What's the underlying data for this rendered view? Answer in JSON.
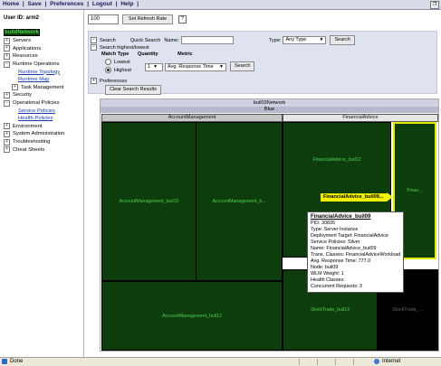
{
  "topbar": {
    "nav": [
      "Home",
      "|",
      "Save",
      "|",
      "Preferences",
      "|",
      "Logout",
      "|",
      "Help",
      "|"
    ],
    "corner_icon": "restore-icon"
  },
  "left": {
    "user": "User ID: arm2",
    "cell": "buildNetwork",
    "tree": [
      {
        "label": "Servers",
        "expand": "+",
        "type": "node"
      },
      {
        "label": "Applications",
        "expand": "+",
        "type": "node"
      },
      {
        "label": "Resources",
        "expand": "+",
        "type": "node"
      },
      {
        "label": "Runtime Operations",
        "expand": "−",
        "type": "node"
      },
      {
        "label": "Runtime Topology",
        "type": "link"
      },
      {
        "label": "Runtime Map",
        "type": "link"
      },
      {
        "label": "Task Management",
        "expand": "+",
        "type": "subnode"
      },
      {
        "label": "Security",
        "expand": "+",
        "type": "node"
      },
      {
        "label": "Operational Policies",
        "expand": "−",
        "type": "node"
      },
      {
        "label": "Service Policies",
        "type": "link"
      },
      {
        "label": "Health Policies",
        "type": "link"
      },
      {
        "label": "Environment",
        "expand": "+",
        "type": "node"
      },
      {
        "label": "System Administration",
        "expand": "+",
        "type": "node"
      },
      {
        "label": "Troubleshooting",
        "expand": "+",
        "type": "node"
      },
      {
        "label": "Cheat Sheets",
        "expand": "+",
        "type": "node"
      }
    ]
  },
  "toolbar": {
    "refresh_value": "100",
    "set_refresh": "Set Refresh Rate",
    "help": "?"
  },
  "search": {
    "search_label": "Search",
    "quick_search": "Quick Search",
    "name_label": "Name:",
    "type_label": "Type:",
    "type_value": "Any Type",
    "search_button": "Search",
    "highest_lowest": "Search highest/lowest",
    "match_type": "Match Type",
    "quantity": "Quantity",
    "metric": "Metric",
    "lowest": "Lowest",
    "highest": "Highest",
    "quantity_value": "1",
    "metric_value": "Avg. Response Time",
    "search_button2": "Search",
    "preferences": "Preferences",
    "clear": "Clear Search Results"
  },
  "map": {
    "root": "buil03Network",
    "group": "Blue",
    "am_header": "AccountManagement",
    "fa_header": "FinancialAdvice",
    "am1": "AccountManagement_buil10",
    "am2": "AccountManagement_b...",
    "am3": "AccountManagement_buil12",
    "fa1": "FinancialAdvice_buil12",
    "fa_sel": "Finan...",
    "st1": "StockTrade_buil13",
    "st2": "StockTrade_...",
    "callout": "FinancialAdvice_buil09..."
  },
  "tooltip": {
    "title": "FinancialAdvice_buil09",
    "lines": [
      "PID: 30835",
      "Type: Server Instance",
      "Deployment Target: FinancialAdvice",
      "Service Policies: Silver",
      "Name: FinancialAdvice_buil09",
      "Trans. Classes: FinancialAdviceWorkload",
      "Avg. Response Time: 777.0",
      "Node: buil09",
      "WLM Weight: 1",
      "Health Classes:",
      "Concurrent Requests: 3"
    ]
  },
  "status": {
    "done": "Done",
    "zone": "Internet"
  }
}
